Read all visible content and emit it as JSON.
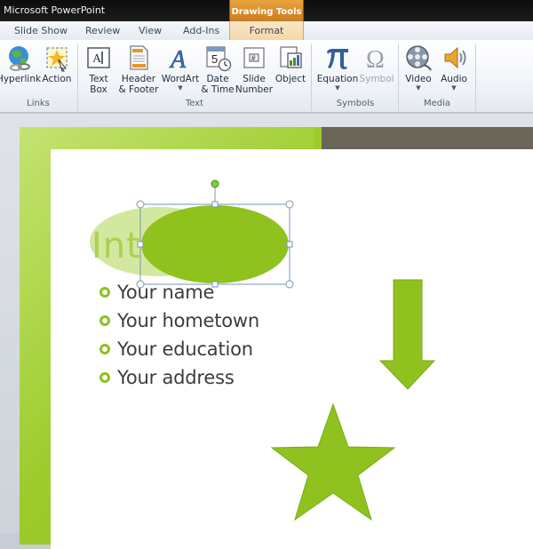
{
  "app": {
    "title": "Microsoft PowerPoint"
  },
  "context_tab": {
    "label": "Drawing Tools"
  },
  "tabs": [
    {
      "label": "Slide Show"
    },
    {
      "label": "Review"
    },
    {
      "label": "View"
    },
    {
      "label": "Add-Ins"
    },
    {
      "label": "Format"
    }
  ],
  "ribbon": {
    "links_group": {
      "label": "Links",
      "hyperlink": "Hyperlink",
      "action": "Action"
    },
    "text_group": {
      "label": "Text",
      "text_box": [
        "Text",
        "Box"
      ],
      "header_footer": [
        "Header",
        "& Footer"
      ],
      "wordart": "WordArt",
      "date_time": [
        "Date",
        "& Time"
      ],
      "slide_number": [
        "Slide",
        "Number"
      ],
      "object": "Object"
    },
    "symbols_group": {
      "label": "Symbols",
      "equation": "Equation",
      "symbol": "Symbol"
    },
    "media_group": {
      "label": "Media",
      "video": "Video",
      "audio": "Audio"
    }
  },
  "slide": {
    "title": "Intr",
    "bullets": [
      "Your name",
      "Your hometown",
      "Your education",
      "Your address"
    ]
  },
  "colors": {
    "accent": "#9ccb2a",
    "dark_bar": "#6a6558",
    "title_bar": "#111111",
    "context_tab": "#e09a35"
  },
  "icons": [
    "hyperlink-icon",
    "action-icon",
    "text-box-icon",
    "header-footer-icon",
    "wordart-icon",
    "date-time-icon",
    "slide-number-icon",
    "object-icon",
    "equation-icon",
    "symbol-icon",
    "video-icon",
    "audio-icon"
  ]
}
